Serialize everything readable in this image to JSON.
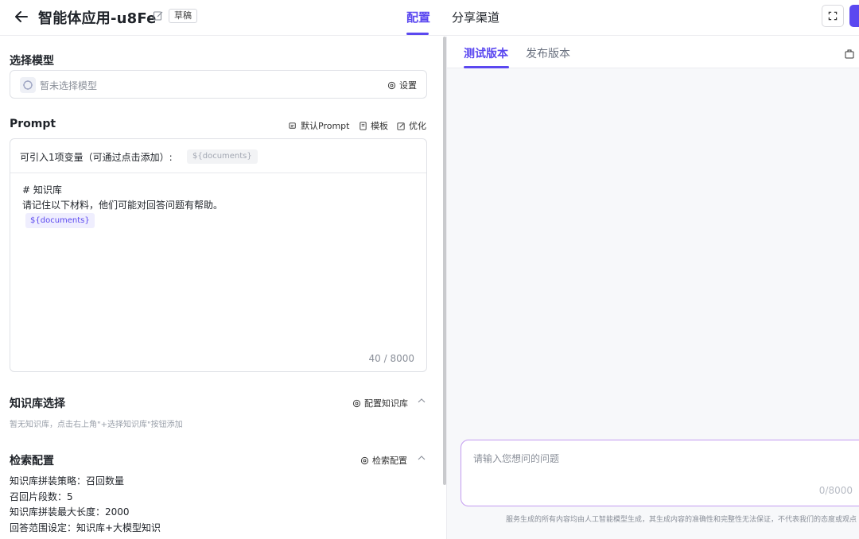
{
  "header": {
    "title": "智能体应用-u8Fe",
    "badge": "草稿",
    "tabs": [
      {
        "label": "配置",
        "active": true
      },
      {
        "label": "分享渠道",
        "active": false
      }
    ],
    "accent": "#5b48f0"
  },
  "model": {
    "section_title": "选择模型",
    "placeholder": "暂未选择模型",
    "settings_label": "设置"
  },
  "prompt": {
    "section_title": "Prompt",
    "tools": {
      "default_prompt": "默认Prompt",
      "template": "模板",
      "optimize": "优化"
    },
    "var_label": "可引入1项变量（可通过点击添加）:",
    "var_tag": "${documents}",
    "lines": [
      "# 知识库",
      "请记住以下材料，他们可能对回答问题有帮助。"
    ],
    "doc_chip": "${documents}",
    "counter": "40 / 8000"
  },
  "knowledge": {
    "section_title": "知识库选择",
    "action_label": "配置知识库",
    "empty_hint": "暂无知识库，点击右上角\"+选择知识库\"按钮添加"
  },
  "retrieval": {
    "section_title": "检索配置",
    "action_label": "检索配置",
    "items": [
      "知识库拼装策略：召回数量",
      "召回片段数：5",
      "知识库拼装最大长度：2000",
      "回答范围设定：知识库+大模型知识"
    ]
  },
  "chat": {
    "tabs": [
      {
        "label": "测试版本",
        "active": true
      },
      {
        "label": "发布版本",
        "active": false
      }
    ],
    "input_placeholder": "请输入您想问的问题",
    "counter": "0/8000",
    "disclaimer": "服务生成的所有内容均由人工智能模型生成，其生成内容的准确性和完整性无法保证，不代表我们的态度或观点"
  }
}
